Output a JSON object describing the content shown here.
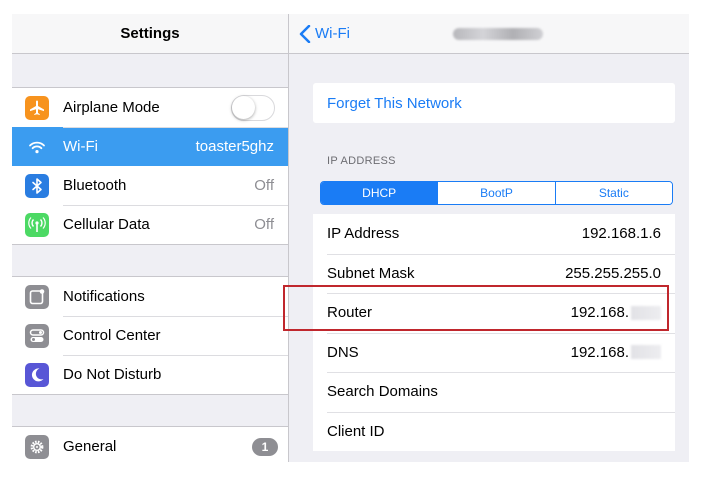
{
  "left": {
    "title": "Settings",
    "groups": [
      [
        {
          "label": "Airplane Mode",
          "icon": "airplane-icon",
          "color": "#f7931e",
          "toggle": false
        },
        {
          "label": "Wi-Fi",
          "icon": "wifi-icon",
          "color": "#3b9cf0",
          "value": "toaster5ghz",
          "selected": true
        },
        {
          "label": "Bluetooth",
          "icon": "bluetooth-icon",
          "color": "#2a7de1",
          "value": "Off"
        },
        {
          "label": "Cellular Data",
          "icon": "cellular-icon",
          "color": "#4cd964",
          "value": "Off"
        }
      ],
      [
        {
          "label": "Notifications",
          "icon": "notifications-icon",
          "color": "#8e8e93"
        },
        {
          "label": "Control Center",
          "icon": "control-center-icon",
          "color": "#8e8e93"
        },
        {
          "label": "Do Not Disturb",
          "icon": "moon-icon",
          "color": "#5856d6"
        }
      ],
      [
        {
          "label": "General",
          "icon": "gear-icon",
          "color": "#8e8e93",
          "badge": "1"
        }
      ]
    ]
  },
  "right": {
    "back_label": "Wi-Fi",
    "forget_label": "Forget This Network",
    "section_header": "IP ADDRESS",
    "segments": [
      "DHCP",
      "BootP",
      "Static"
    ],
    "active_segment": 0,
    "rows": [
      {
        "label": "IP Address",
        "value": "192.168.1.6"
      },
      {
        "label": "Subnet Mask",
        "value": "255.255.255.0"
      },
      {
        "label": "Router",
        "value": "192.168.",
        "redacted": true
      },
      {
        "label": "DNS",
        "value": "192.168.",
        "redacted": true
      },
      {
        "label": "Search Domains",
        "value": ""
      },
      {
        "label": "Client ID",
        "value": ""
      }
    ]
  },
  "colors": {
    "accent": "#1a7cf5",
    "selected": "#3b9cf0",
    "highlight": "#c0272d"
  }
}
